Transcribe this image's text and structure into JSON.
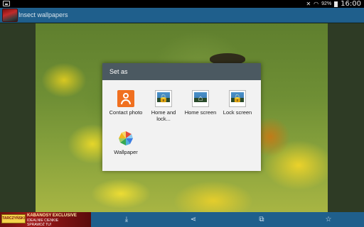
{
  "status_bar": {
    "battery_percent": "92%",
    "time": "16:00",
    "icons": [
      "gallery-icon",
      "mute-icon",
      "wifi-icon",
      "battery-icon"
    ]
  },
  "action_bar": {
    "title": "Insect wallpapers",
    "app_icon": "insect-app-icon"
  },
  "dialog": {
    "title": "Set as",
    "options": [
      {
        "label": "Contact photo",
        "icon": "contact-icon"
      },
      {
        "label": "Home and lock...",
        "icon": "home-lock-icon"
      },
      {
        "label": "Home screen",
        "icon": "home-screen-icon"
      },
      {
        "label": "Lock screen",
        "icon": "lock-screen-icon"
      },
      {
        "label": "Wallpaper",
        "icon": "wallpaper-icon"
      }
    ]
  },
  "ad": {
    "badge": "TARCZYŃSKI",
    "line1": "KABANOSY EXCLUSIVE",
    "line2": "IDEALNIE CIENKIE",
    "line3": "SPRAWDŹ TU!"
  },
  "bottom_actions": [
    "download-icon",
    "share-icon",
    "crop-icon",
    "star-icon"
  ],
  "colors": {
    "action_bar": "#1f5f8c",
    "dialog_header": "#4b5961",
    "dialog_body": "#f2f2f2",
    "contact_icon": "#f07020"
  }
}
